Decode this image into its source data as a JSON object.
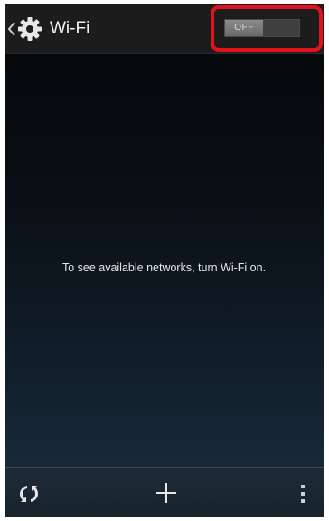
{
  "header": {
    "title": "Wi-Fi",
    "back_icon": "chevron-left-icon",
    "settings_icon": "gear-icon"
  },
  "wifi_toggle": {
    "label": "OFF",
    "state": "off"
  },
  "main": {
    "empty_message": "To see available networks, turn Wi-Fi on."
  },
  "bottom_bar": {
    "items": [
      {
        "icon": "scan-icon"
      },
      {
        "icon": "add-icon"
      },
      {
        "icon": "overflow-menu-icon"
      }
    ]
  },
  "colors": {
    "highlight": "#e0121c",
    "action_bar": "#1c1c1c",
    "background_top": "#050709",
    "background_bottom": "#1c2e3d"
  }
}
